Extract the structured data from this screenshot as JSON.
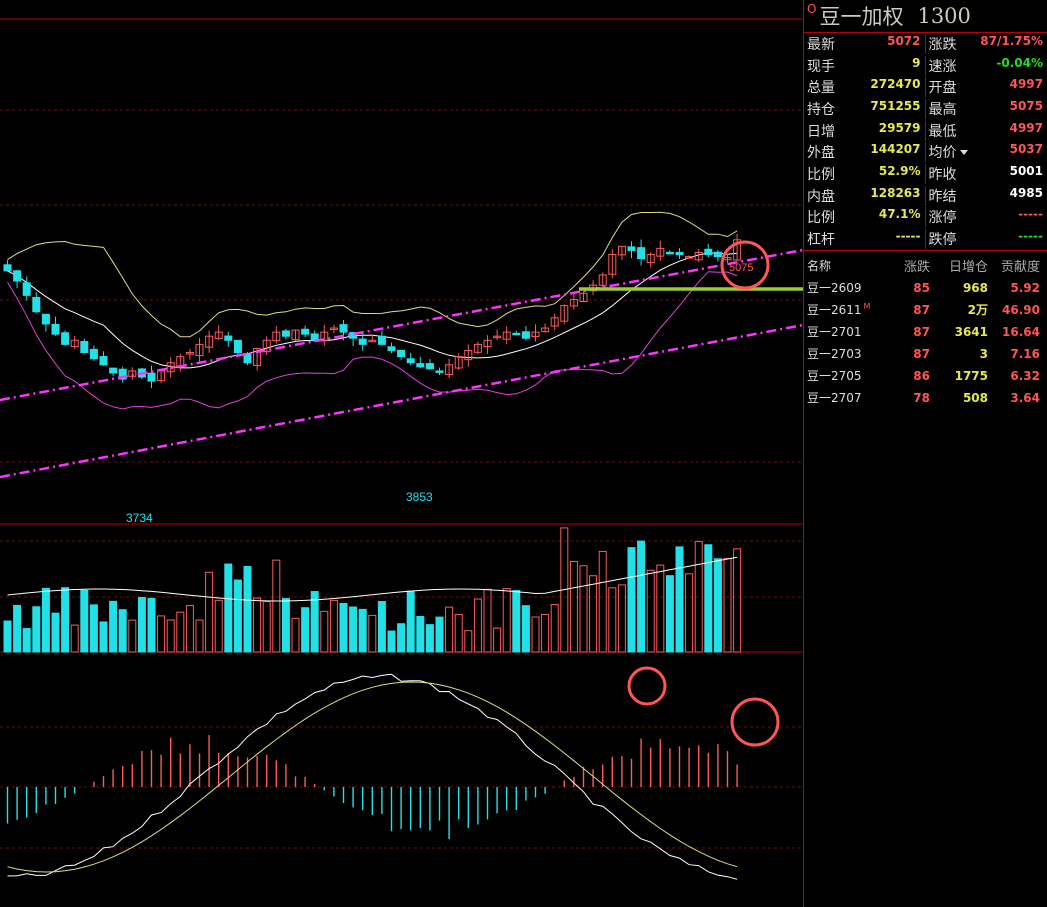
{
  "chart": {
    "price_lows": [
      "3734",
      "3853"
    ],
    "price_high": "5075",
    "colors": {
      "up": "#ff5a5a",
      "down": "#22e0e8",
      "upper_band": "#dddd80",
      "lower_band": "#e040e0",
      "channel": "#ff33ff",
      "resistance": "#9acd32",
      "marker": "#ff5555"
    },
    "chart_data": {
      "type": "candlestick",
      "closes": [
        4920,
        4870,
        4800,
        4720,
        4660,
        4610,
        4560,
        4580,
        4520,
        4490,
        4460,
        4420,
        4390,
        4430,
        4400,
        4380,
        4430,
        4470,
        4500,
        4520,
        4560,
        4600,
        4620,
        4580,
        4520,
        4470,
        4540,
        4580,
        4620,
        4600,
        4630,
        4610,
        4580,
        4620,
        4640,
        4620,
        4590,
        4560,
        4580,
        4560,
        4530,
        4500,
        4470,
        4450,
        4440,
        4430,
        4460,
        4500,
        4530,
        4560,
        4580,
        4600,
        4620,
        4610,
        4590,
        4620,
        4640,
        4690,
        4750,
        4780,
        4810,
        4850,
        4900,
        5000,
        5040,
        5020,
        4980,
        5000,
        5030,
        5010,
        5000,
        4990,
        5010,
        5000,
        4990,
        4985,
        5072
      ]
    }
  },
  "panel": {
    "title": "豆一加权",
    "code": "1300",
    "marker": "O",
    "quote": [
      {
        "l_label": "最新",
        "l_value": "5072",
        "l_color": "red",
        "r_label": "涨跌",
        "r_value": "87/1.75%",
        "r_color": "red"
      },
      {
        "l_label": "现手",
        "l_value": "9",
        "l_color": "yel",
        "r_label": "速涨",
        "r_value": "-0.04%",
        "r_color": "grn"
      },
      {
        "l_label": "总量",
        "l_value": "272470",
        "l_color": "yel",
        "r_label": "开盘",
        "r_value": "4997",
        "r_color": "red"
      },
      {
        "l_label": "持仓",
        "l_value": "751255",
        "l_color": "yel",
        "r_label": "最高",
        "r_value": "5075",
        "r_color": "red"
      },
      {
        "l_label": "日增",
        "l_value": "29579",
        "l_color": "yel",
        "r_label": "最低",
        "r_value": "4997",
        "r_color": "red"
      },
      {
        "l_label": "外盘",
        "l_value": "144207",
        "l_color": "yel",
        "r_label": "均价",
        "r_value": "5037",
        "r_color": "red"
      },
      {
        "l_label": "比例",
        "l_value": "52.9%",
        "l_color": "yel",
        "r_label": "昨收",
        "r_value": "5001",
        "r_color": "wht"
      },
      {
        "l_label": "内盘",
        "l_value": "128263",
        "l_color": "yel",
        "r_label": "昨结",
        "r_value": "4985",
        "r_color": "wht"
      },
      {
        "l_label": "比例",
        "l_value": "47.1%",
        "l_color": "yel",
        "r_label": "涨停",
        "r_value": "-----",
        "r_color": "red"
      },
      {
        "l_label": "杠杆",
        "l_value": "-----",
        "l_color": "yel",
        "r_label": "跌停",
        "r_value": "-----",
        "r_color": "grn"
      }
    ],
    "contracts_header": {
      "name": "名称",
      "change": "涨跌",
      "oi": "日增仓",
      "contrib": "贡献度"
    },
    "contracts": [
      {
        "name": "豆一2609",
        "badge": "",
        "change": "85",
        "oi": "968",
        "contrib": "5.92"
      },
      {
        "name": "豆一2611",
        "badge": "M",
        "change": "87",
        "oi": "2万",
        "contrib": "46.90"
      },
      {
        "name": "豆一2701",
        "badge": "",
        "change": "87",
        "oi": "3641",
        "contrib": "16.64"
      },
      {
        "name": "豆一2703",
        "badge": "",
        "change": "87",
        "oi": "3",
        "contrib": "7.16"
      },
      {
        "name": "豆一2705",
        "badge": "",
        "change": "86",
        "oi": "1775",
        "contrib": "6.32"
      },
      {
        "name": "豆一2707",
        "badge": "",
        "change": "78",
        "oi": "508",
        "contrib": "3.64"
      }
    ]
  }
}
